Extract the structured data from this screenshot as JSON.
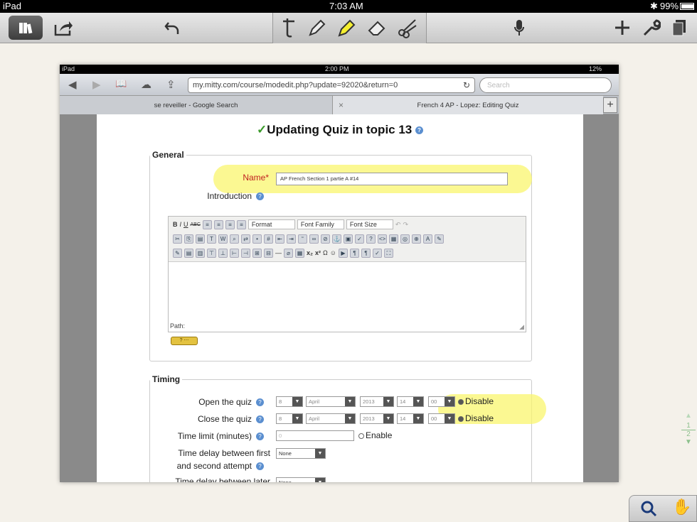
{
  "status": {
    "device": "iPad",
    "time": "7:03 AM",
    "battery": "99%"
  },
  "toolbar": {
    "library_icon": "library-icon",
    "share_icon": "share-icon",
    "undo_icon": "undo-icon",
    "tools": [
      "text-tool-icon",
      "pen-tool-icon",
      "highlighter-icon",
      "eraser-icon",
      "scissors-icon"
    ],
    "mic_icon": "microphone-icon",
    "add_icon": "plus-icon",
    "settings_icon": "wrench-icon",
    "pages_icon": "pages-icon"
  },
  "screenshot": {
    "status": {
      "device": "iPad",
      "time": "2:00 PM",
      "battery": "12%"
    },
    "url": "my.mitty.com/course/modedit.php?update=92020&return=0",
    "search_placeholder": "Search",
    "tabs": [
      "se reveiller - Google Search",
      "French 4 AP - Lopez: Editing Quiz"
    ],
    "tab_close": "×",
    "tab_add": "+",
    "page": {
      "title": "Updating Quiz in topic 13",
      "general_legend": "General",
      "name_label": "Name*",
      "name_value": "AP French Section 1 partie A #14",
      "intro_label": "Introduction",
      "editor": {
        "format": "Format",
        "font_family": "Font Family",
        "font_size": "Font Size",
        "path_label": "Path:"
      },
      "help_button": "? ",
      "timing_legend": "Timing",
      "open_label": "Open the quiz",
      "close_label": "Close the quiz",
      "date": {
        "day": "8",
        "month": "April",
        "year": "2013",
        "hour": "14",
        "minute": "00"
      },
      "disable_label": "Disable",
      "time_limit_label": "Time limit (minutes)",
      "time_limit_value": "0",
      "enable_label": "Enable",
      "delay1_label_line1": "Time delay between first",
      "delay1_label_line2": "and second attempt",
      "delay_value": "None",
      "delay2_label": "Time delay between later"
    }
  },
  "pager": {
    "page1": "1",
    "page2": "2"
  },
  "colors": {
    "highlight": "#faf56e",
    "accent_green": "#3a9a2a"
  }
}
